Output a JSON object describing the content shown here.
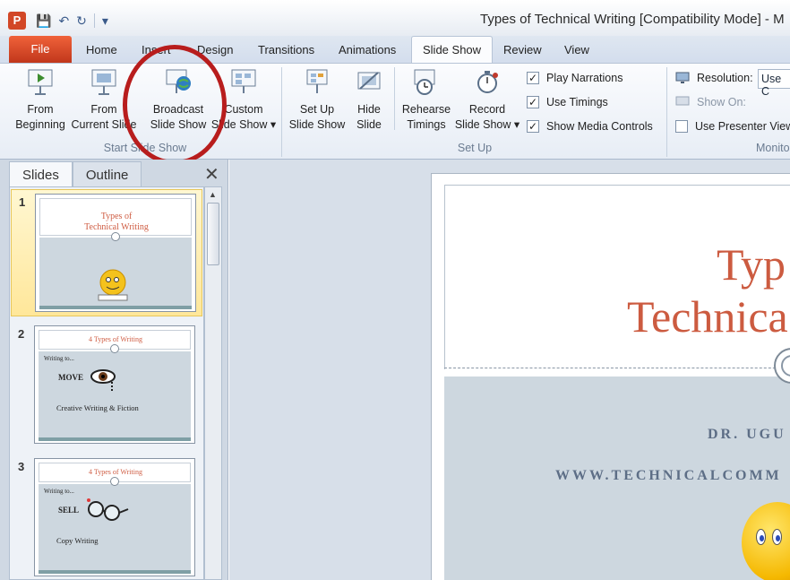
{
  "window": {
    "app_icon_letter": "P",
    "title": "Types of Technical Writing [Compatibility Mode]  -  M"
  },
  "quick_access": {
    "icons": [
      "save-icon",
      "undo-icon",
      "redo-icon",
      "customize-qat-icon"
    ]
  },
  "tabs": {
    "file": "File",
    "items": [
      "Home",
      "Insert",
      "Design",
      "Transitions",
      "Animations",
      "Slide Show",
      "Review",
      "View"
    ],
    "active": "Slide Show"
  },
  "ribbon": {
    "start_group": {
      "label": "Start Slide Show",
      "from_beginning": [
        "From",
        "Beginning"
      ],
      "from_current": [
        "From",
        "Current Slide"
      ],
      "broadcast": [
        "Broadcast",
        "Slide Show"
      ],
      "custom": [
        "Custom",
        "Slide Show ▾"
      ]
    },
    "setup_group": {
      "label": "Set Up",
      "setup": [
        "Set Up",
        "Slide Show"
      ],
      "hide": [
        "Hide",
        "Slide"
      ],
      "rehearse": [
        "Rehearse",
        "Timings"
      ],
      "record": [
        "Record",
        "Slide Show ▾"
      ],
      "play_narrations": "Play Narrations",
      "use_timings": "Use Timings",
      "show_media_controls": "Show Media Controls",
      "play_narrations_checked": true,
      "use_timings_checked": true,
      "show_media_controls_checked": true
    },
    "monitors_group": {
      "label": "Monito",
      "resolution_label": "Resolution:",
      "resolution_value": "Use C",
      "show_on_label": "Show On:",
      "presenter_view": "Use Presenter View",
      "presenter_view_checked": false
    }
  },
  "pane": {
    "tabs": [
      "Slides",
      "Outline"
    ],
    "close_glyph": "✕",
    "slides": [
      {
        "num": "1",
        "title_lines": [
          "Types of",
          "Technical Writing"
        ],
        "selected": true
      },
      {
        "num": "2",
        "title": "4 Types of Writing",
        "bullet": "Writing to...",
        "keyword": "MOVE",
        "caption": "Creative Writing & Fiction",
        "selected": false
      },
      {
        "num": "3",
        "title": "4 Types of Writing",
        "bullet": "Writing to...",
        "keyword": "SELL",
        "caption": "Copy Writing",
        "selected": false
      }
    ]
  },
  "main_slide": {
    "title_lines": [
      "Typ",
      "Technica"
    ],
    "author": "DR. UGU",
    "website": "WWW.TECHNICALCOMM"
  },
  "colors": {
    "file_tab": "#d9471f",
    "annotation_circle": "#b81d1d",
    "slide_title": "#cc5b40"
  }
}
